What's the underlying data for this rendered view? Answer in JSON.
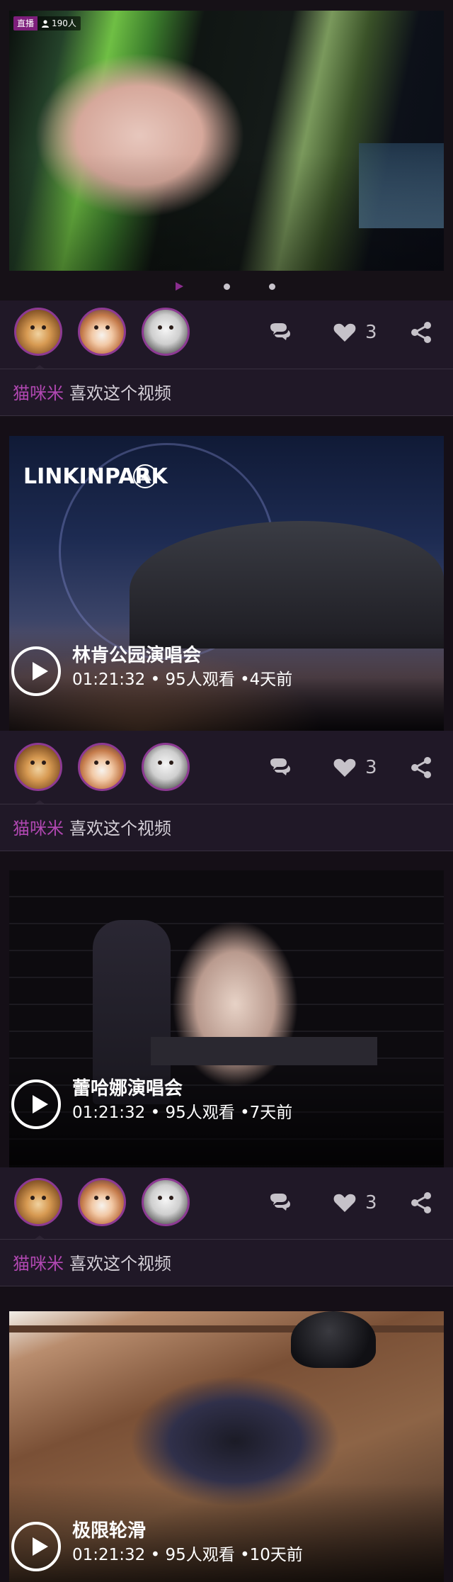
{
  "live": {
    "tag": "直播",
    "viewers": "190人"
  },
  "social": {
    "like_count": "3"
  },
  "like_line": {
    "user": "猫咪米",
    "text": "喜欢这个视频"
  },
  "videos": [
    {
      "brand": "LINKINPARK",
      "title": "林肯公园演唱会",
      "meta": "01:21:32 • 95人观看 •4天前"
    },
    {
      "title": "蕾哈娜演唱会",
      "meta": "01:21:32 • 95人观看 •7天前"
    },
    {
      "title": "极限轮滑",
      "meta": "01:21:32 • 95人观看 •10天前"
    }
  ],
  "colors": {
    "accent": "#8d3a93",
    "username": "#b047b1",
    "background": "#201827"
  },
  "icons": [
    "play-arrow-icon",
    "dot-icon",
    "person-icon",
    "comment-icon",
    "heart-icon",
    "share-icon",
    "play-button-icon"
  ]
}
